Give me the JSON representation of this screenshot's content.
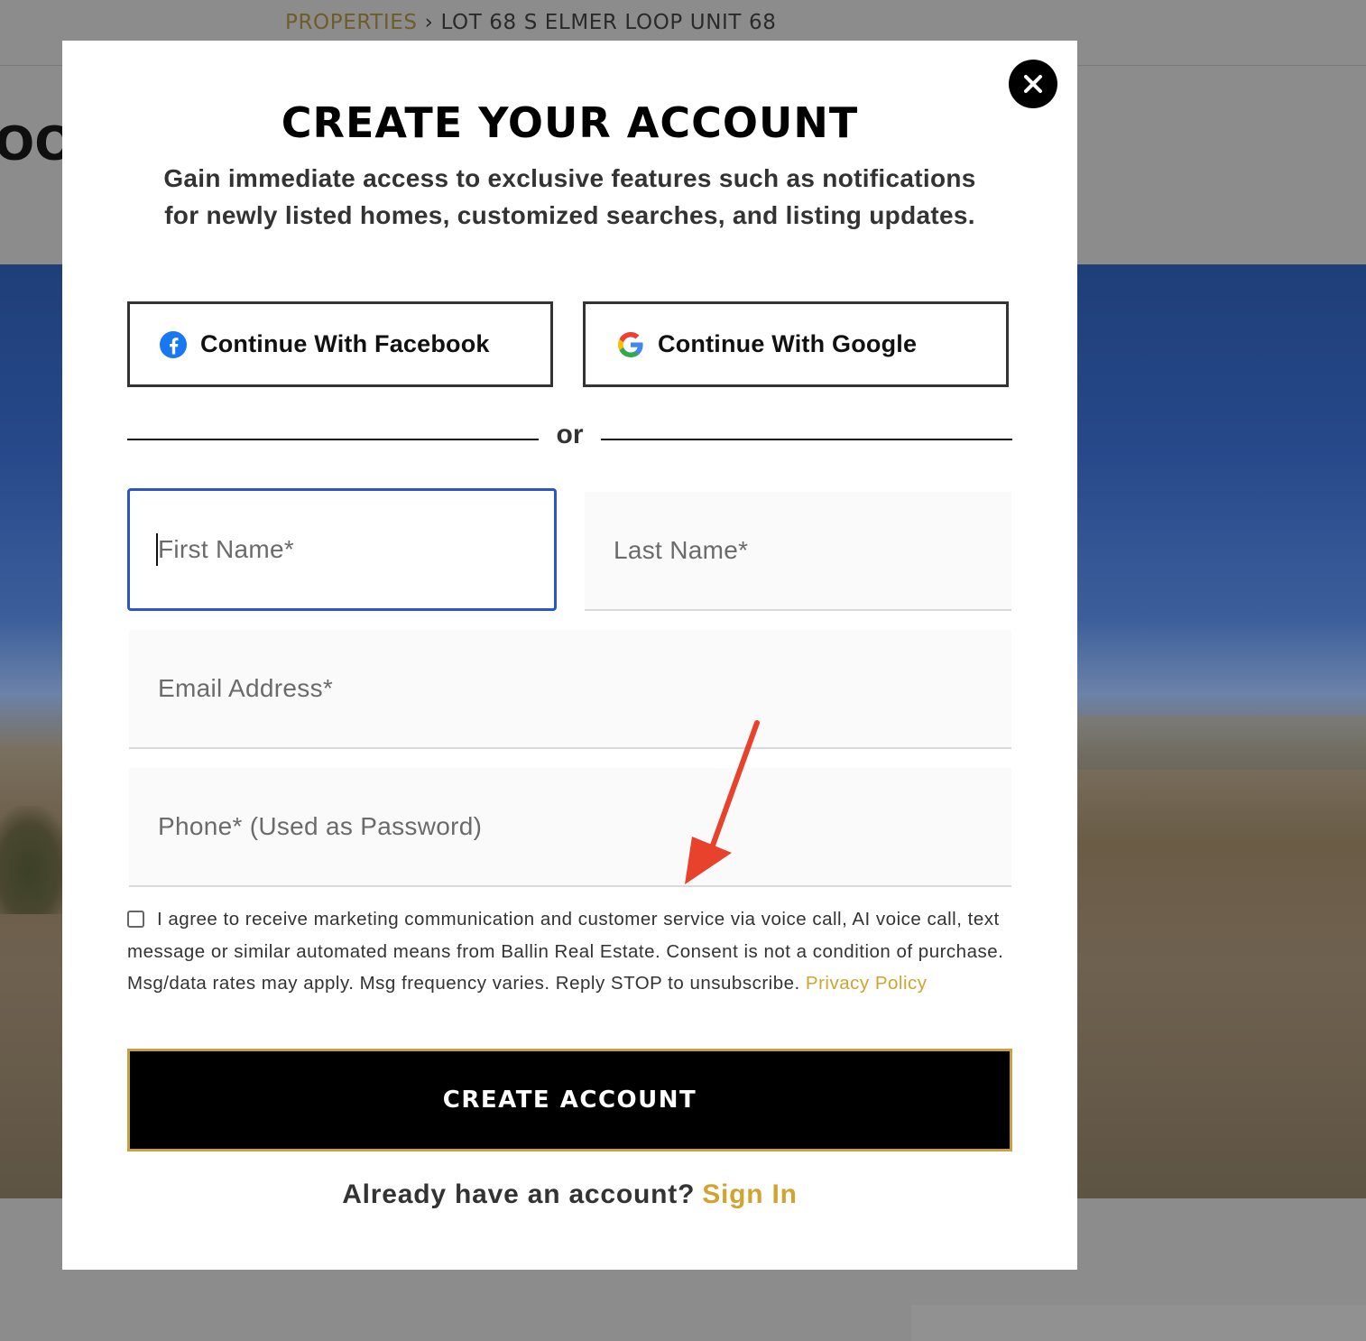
{
  "breadcrumb": {
    "link": "PROPERTIES",
    "separator": "›",
    "current": "LOT 68 S ELMER LOOP UNIT 68"
  },
  "background": {
    "title_fragment": "OOI"
  },
  "modal": {
    "title": "CREATE YOUR ACCOUNT",
    "subtitle": "Gain immediate access to exclusive features such as notifications for newly listed homes, customized searches, and listing updates.",
    "close_icon": "close-icon",
    "facebook_label": "Continue With Facebook",
    "google_label": "Continue With Google",
    "divider_text": "or",
    "fields": {
      "first_name_placeholder": "First Name*",
      "last_name_placeholder": "Last Name*",
      "email_placeholder": "Email Address*",
      "phone_placeholder": "Phone* (Used as Password)"
    },
    "consent_text": "I agree to receive marketing communication and customer service via voice call, AI voice call, text message or similar automated means from Ballin Real Estate. Consent is not a condition of purchase. Msg/data rates may apply. Msg frequency varies. Reply STOP to unsubscribe.",
    "privacy_link": "Privacy Policy",
    "create_button": "CREATE ACCOUNT",
    "signin_prompt": "Already have an account?",
    "signin_link": "Sign In"
  },
  "colors": {
    "accent_gold": "#d1a331",
    "focus_blue": "#2b56c9",
    "annotation_red": "#e8412c"
  }
}
